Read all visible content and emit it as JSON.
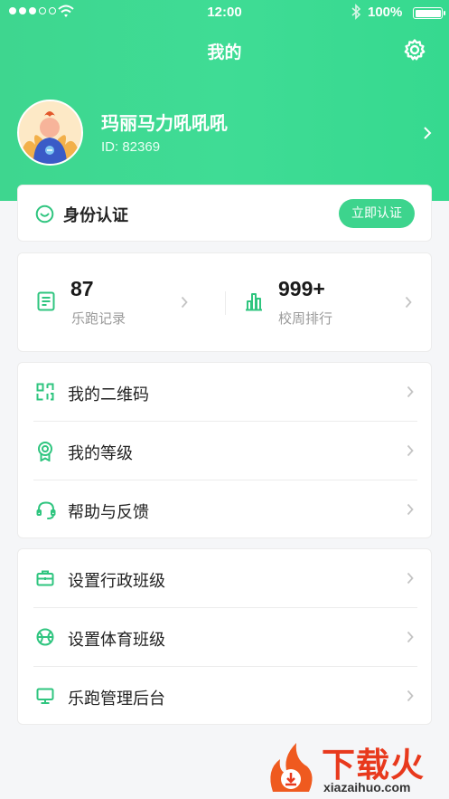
{
  "status_bar": {
    "time": "12:00",
    "battery": "100%",
    "signal_icon": "signal-dots-icon",
    "wifi_icon": "wifi-icon",
    "bluetooth_icon": "bluetooth-icon"
  },
  "nav": {
    "title": "我的",
    "settings_icon": "gear-icon"
  },
  "profile": {
    "name": "玛丽马力吼吼吼",
    "id_text": "ID: 82369"
  },
  "auth": {
    "title": "身份认证",
    "button": "立即认证"
  },
  "stats": [
    {
      "value": "87",
      "label": "乐跑记录",
      "icon": "record-icon"
    },
    {
      "value": "999+",
      "label": "校周排行",
      "icon": "rank-chart-icon"
    }
  ],
  "menu_group_1": [
    {
      "label": "我的二维码",
      "icon": "qrcode-icon"
    },
    {
      "label": "我的等级",
      "icon": "medal-icon"
    },
    {
      "label": "帮助与反馈",
      "icon": "headset-icon"
    }
  ],
  "menu_group_2": [
    {
      "label": "设置行政班级",
      "icon": "briefcase-icon"
    },
    {
      "label": "设置体育班级",
      "icon": "basketball-icon"
    },
    {
      "label": "乐跑管理后台",
      "icon": "monitor-icon"
    }
  ],
  "watermark": {
    "text": "下载火",
    "url": "xiazaihuo.com"
  },
  "colors": {
    "accent": "#3dd48d",
    "header_bg": "#3fdc95",
    "background": "#f5f6f8",
    "watermark": "#e8391d"
  }
}
